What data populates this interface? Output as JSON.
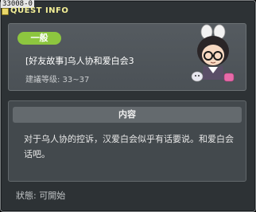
{
  "window": {
    "id_tag": "33008-0",
    "title": "QUEST INFO"
  },
  "quest": {
    "category": "一般",
    "name": "[好友故事]乌人协和爱白会3",
    "level_requirement": "建議等级: 33~37"
  },
  "content": {
    "header": "内容",
    "description": "对于乌人协的控诉，汉爱白会似乎有话要说。和爱白会话吧。"
  },
  "status": {
    "label": "狀態:",
    "value": "可開始"
  },
  "colors": {
    "window_bg": "#2d3235",
    "title_yellow": "#f3ef96",
    "category_green": "#8dc63f",
    "panel_bg": "#43494d"
  }
}
